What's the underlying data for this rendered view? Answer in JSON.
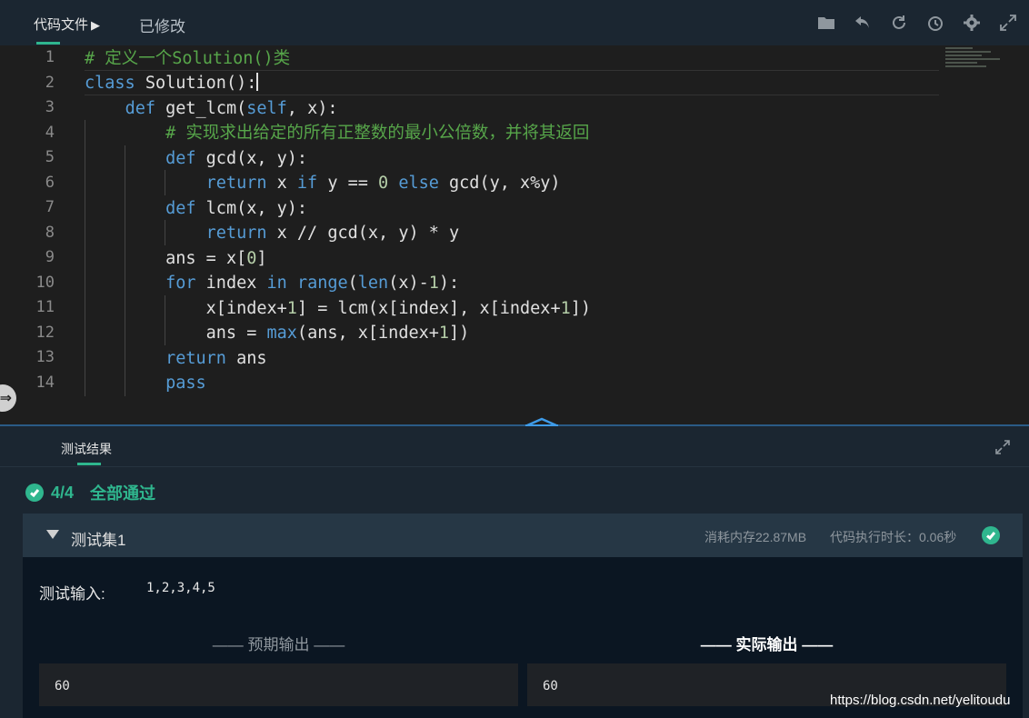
{
  "topbar": {
    "file_tab": "代码文件",
    "file_tab_arrow": "▶",
    "modified_tab": "已修改",
    "tools": [
      "folder-icon",
      "undo-icon",
      "refresh-icon",
      "history-icon",
      "settings-icon",
      "fullscreen-icon"
    ]
  },
  "editor": {
    "line_numbers": [
      "1",
      "2",
      "3",
      "4",
      "5",
      "6",
      "7",
      "8",
      "9",
      "10",
      "11",
      "12",
      "13",
      "14"
    ],
    "lines": [
      "# 定义一个Solution()类",
      "class Solution():",
      "    def get_lcm(self, x):",
      "        # 实现求出给定的所有正整数的最小公倍数，并将其返回",
      "        def gcd(x, y):",
      "            return x if y == 0 else gcd(y, x%y)",
      "        def lcm(x, y):",
      "            return x // gcd(x, y) * y",
      "        ans = x[0]",
      "        for index in range(len(x)-1):",
      "            x[index+1] = lcm(x[index], x[index+1])",
      "            ans = max(ans, x[index+1])",
      "        return ans",
      "        pass"
    ]
  },
  "results": {
    "tab_label": "测试结果",
    "summary_count": "4/4",
    "summary_text": "全部通过",
    "test_set": {
      "title": "测试集1",
      "memory": "消耗内存22.87MB",
      "time": "代码执行时长：0.06秒",
      "input_label": "测试输入:",
      "input_value": "1,2,3,4,5",
      "expected_label": "—— 预期输出 ——",
      "actual_label": "—— 实际输出 ——",
      "expected_value": "60",
      "actual_value": "60"
    }
  },
  "watermark": "https://blog.csdn.net/yelitoudu",
  "colors": {
    "accent": "#2fb68e",
    "keyword": "#569cd6",
    "comment": "#57a64a",
    "number": "#b5cea8"
  }
}
